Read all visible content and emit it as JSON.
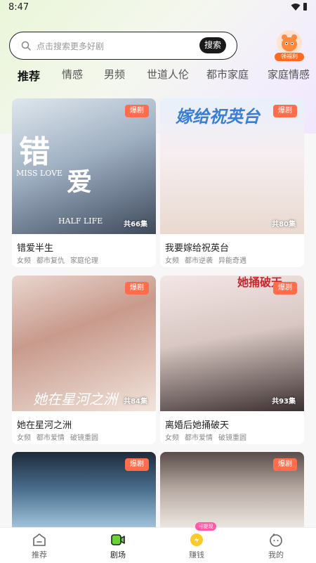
{
  "status": {
    "time": "8:47"
  },
  "search": {
    "placeholder": "点击搜索更多好剧",
    "button": "搜索"
  },
  "welfare": {
    "label": "领福利"
  },
  "tabs": [
    "推荐",
    "情感",
    "男频",
    "世道人伦",
    "都市家庭",
    "家庭情感"
  ],
  "dramas": [
    {
      "title": "错爱半生",
      "badge": "爆剧",
      "episodes": "共66集",
      "tags": [
        "女频",
        "都市复仇",
        "家庭伦理"
      ],
      "poster_text": [
        "错",
        "爱",
        "MISS LOVE",
        "HALF LIFE"
      ]
    },
    {
      "title": "我要嫁给祝英台",
      "badge": "爆剧",
      "episodes": "共80集",
      "tags": [
        "女频",
        "都市逆袭",
        "异能奇遇"
      ],
      "poster_text": [
        "嫁给祝英台"
      ]
    },
    {
      "title": "她在星河之洲",
      "badge": "爆剧",
      "episodes": "共84集",
      "tags": [
        "女频",
        "都市爱情",
        "破镜重圆"
      ],
      "poster_text": [
        "她在星河之洲"
      ]
    },
    {
      "title": "离婚后她捅破天",
      "badge": "爆剧",
      "episodes": "共93集",
      "tags": [
        "女频",
        "都市爱情",
        "破镜重圆"
      ],
      "poster_text": [
        "她捅破天"
      ]
    },
    {
      "badge": "爆剧"
    },
    {
      "badge": "爆剧"
    }
  ],
  "bottom_nav": [
    {
      "label": "推荐",
      "icon": "home-icon"
    },
    {
      "label": "剧场",
      "icon": "video-icon"
    },
    {
      "label": "赚钱",
      "icon": "coin-icon",
      "badge": "可提现"
    },
    {
      "label": "我的",
      "icon": "profile-icon"
    }
  ],
  "colors": {
    "badge": "#ff6d4d",
    "accent_green": "#6bd23a",
    "welfare": "#ff6a1c",
    "earn_badge": "#ff5aa5"
  }
}
